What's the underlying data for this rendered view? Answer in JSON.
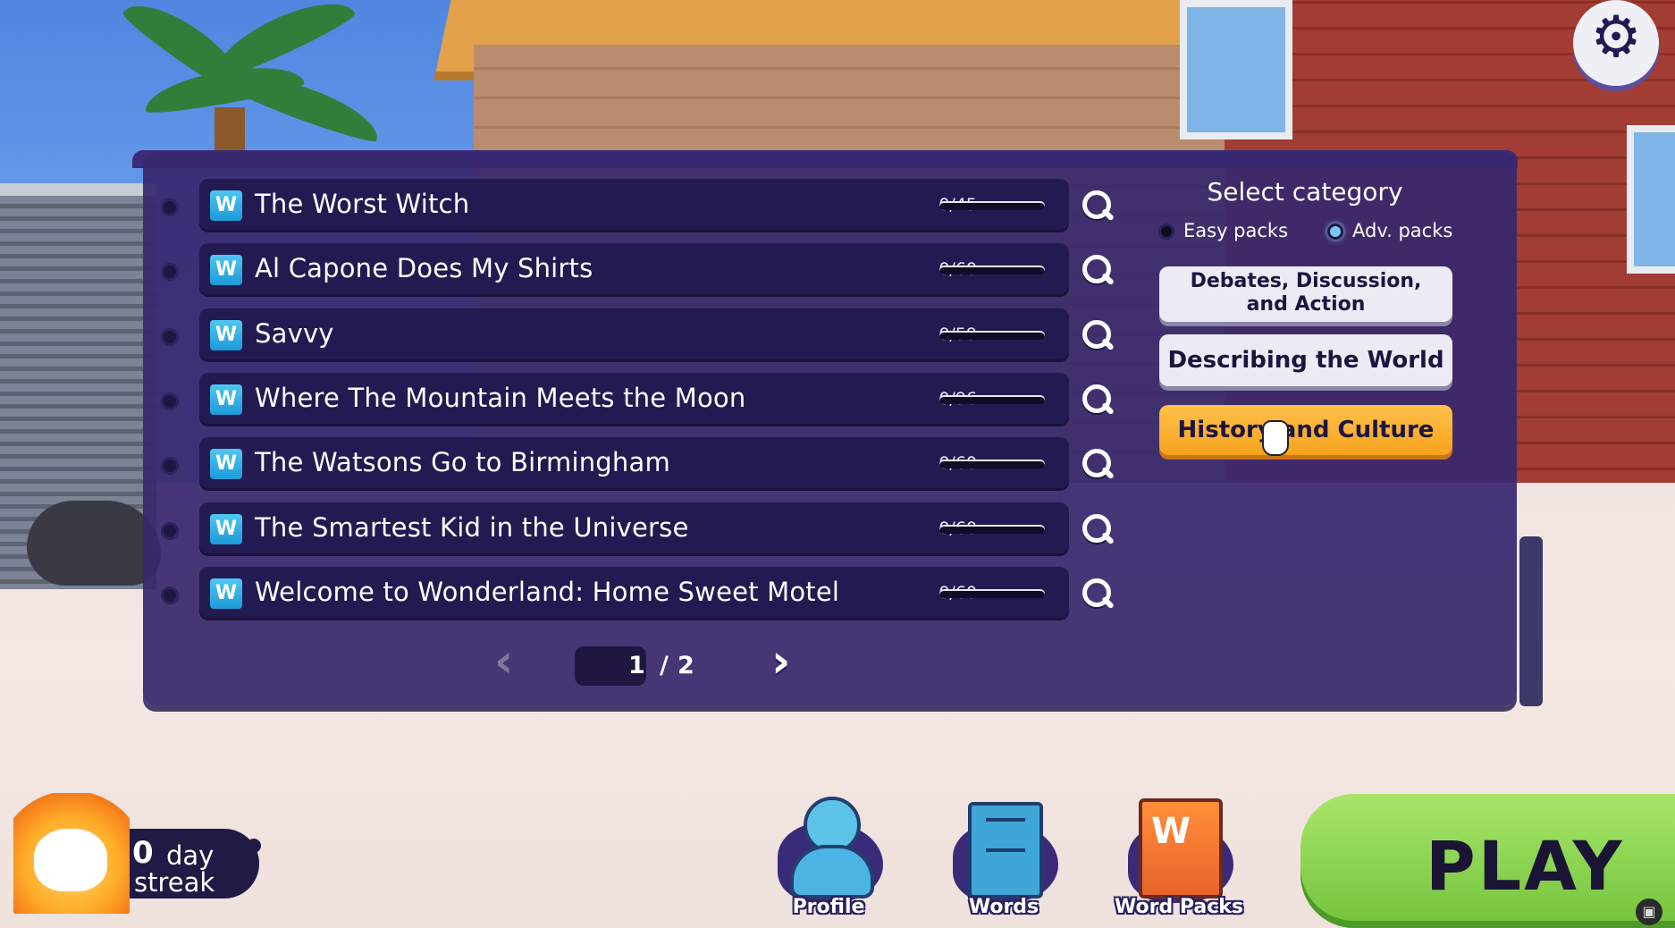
{
  "packs": [
    {
      "title": "The Worst Witch",
      "count": "0/45",
      "progress": 0
    },
    {
      "title": "Al Capone Does My Shirts",
      "count": "0/60",
      "progress": 0
    },
    {
      "title": "Savvy",
      "count": "0/59",
      "progress": 0
    },
    {
      "title": "Where The Mountain Meets the Moon",
      "count": "0/96",
      "progress": 0
    },
    {
      "title": "The Watsons Go to Birmingham",
      "count": "0/60",
      "progress": 0
    },
    {
      "title": "The Smartest Kid in the Universe",
      "count": "0/60",
      "progress": 0
    },
    {
      "title": "Welcome to Wonderland: Home Sweet Motel",
      "count": "0/60",
      "progress": 0
    }
  ],
  "pack_icon_letter": "W",
  "pager": {
    "current": "1",
    "separator": "/",
    "total": "2"
  },
  "category": {
    "title": "Select category",
    "easy_label": "Easy packs",
    "adv_label": "Adv. packs",
    "selected_mode": "Adv. packs",
    "buttons": [
      {
        "line1": "Debates, Discussion,",
        "line2": "and Action"
      },
      {
        "label": "Describing the World"
      },
      {
        "label": "History and Culture",
        "active": true
      }
    ]
  },
  "streak": {
    "count": "0",
    "unit": "day",
    "label": "streak"
  },
  "nav": {
    "profile": "Profile",
    "words": "Words",
    "word_packs": "Word Packs"
  },
  "play_label": "PLAY",
  "colors": {
    "panel": "#38286e",
    "accent_orange": "#f7a21d",
    "play_green": "#73c33c"
  }
}
